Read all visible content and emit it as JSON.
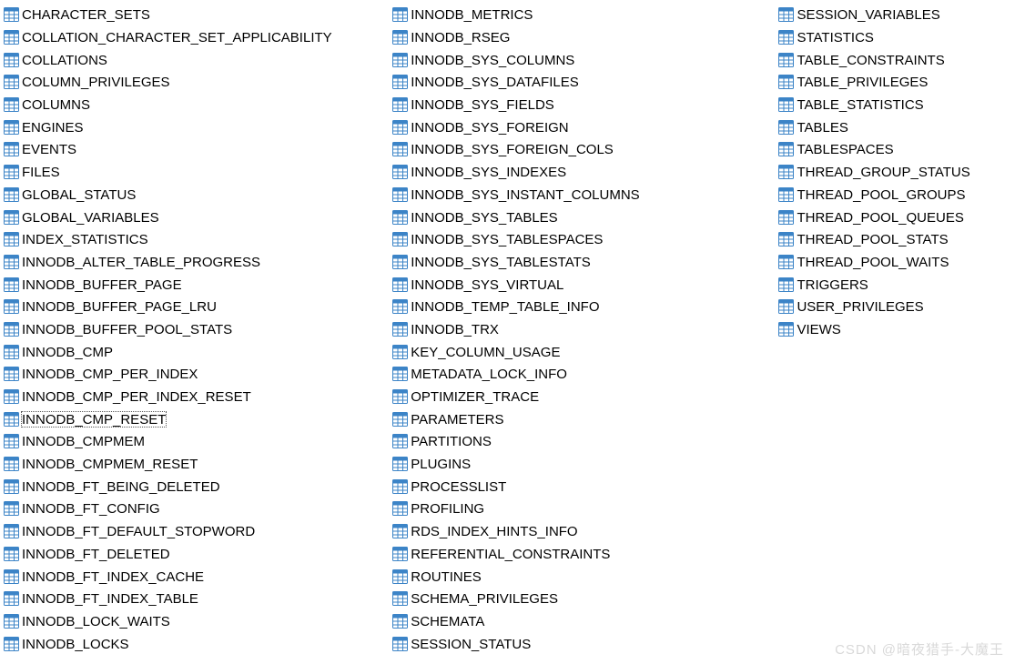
{
  "columns": [
    {
      "items": [
        {
          "label": "CHARACTER_SETS",
          "selected": false
        },
        {
          "label": "COLLATION_CHARACTER_SET_APPLICABILITY",
          "selected": false
        },
        {
          "label": "COLLATIONS",
          "selected": false
        },
        {
          "label": "COLUMN_PRIVILEGES",
          "selected": false
        },
        {
          "label": "COLUMNS",
          "selected": false
        },
        {
          "label": "ENGINES",
          "selected": false
        },
        {
          "label": "EVENTS",
          "selected": false
        },
        {
          "label": "FILES",
          "selected": false
        },
        {
          "label": "GLOBAL_STATUS",
          "selected": false
        },
        {
          "label": "GLOBAL_VARIABLES",
          "selected": false
        },
        {
          "label": "INDEX_STATISTICS",
          "selected": false
        },
        {
          "label": "INNODB_ALTER_TABLE_PROGRESS",
          "selected": false
        },
        {
          "label": "INNODB_BUFFER_PAGE",
          "selected": false
        },
        {
          "label": "INNODB_BUFFER_PAGE_LRU",
          "selected": false
        },
        {
          "label": "INNODB_BUFFER_POOL_STATS",
          "selected": false
        },
        {
          "label": "INNODB_CMP",
          "selected": false
        },
        {
          "label": "INNODB_CMP_PER_INDEX",
          "selected": false
        },
        {
          "label": "INNODB_CMP_PER_INDEX_RESET",
          "selected": false
        },
        {
          "label": "INNODB_CMP_RESET",
          "selected": true
        },
        {
          "label": "INNODB_CMPMEM",
          "selected": false
        },
        {
          "label": "INNODB_CMPMEM_RESET",
          "selected": false
        },
        {
          "label": "INNODB_FT_BEING_DELETED",
          "selected": false
        },
        {
          "label": "INNODB_FT_CONFIG",
          "selected": false
        },
        {
          "label": "INNODB_FT_DEFAULT_STOPWORD",
          "selected": false
        },
        {
          "label": "INNODB_FT_DELETED",
          "selected": false
        },
        {
          "label": "INNODB_FT_INDEX_CACHE",
          "selected": false
        },
        {
          "label": "INNODB_FT_INDEX_TABLE",
          "selected": false
        },
        {
          "label": "INNODB_LOCK_WAITS",
          "selected": false
        },
        {
          "label": "INNODB_LOCKS",
          "selected": false
        }
      ]
    },
    {
      "items": [
        {
          "label": "INNODB_METRICS",
          "selected": false
        },
        {
          "label": "INNODB_RSEG",
          "selected": false
        },
        {
          "label": "INNODB_SYS_COLUMNS",
          "selected": false
        },
        {
          "label": "INNODB_SYS_DATAFILES",
          "selected": false
        },
        {
          "label": "INNODB_SYS_FIELDS",
          "selected": false
        },
        {
          "label": "INNODB_SYS_FOREIGN",
          "selected": false
        },
        {
          "label": "INNODB_SYS_FOREIGN_COLS",
          "selected": false
        },
        {
          "label": "INNODB_SYS_INDEXES",
          "selected": false
        },
        {
          "label": "INNODB_SYS_INSTANT_COLUMNS",
          "selected": false
        },
        {
          "label": "INNODB_SYS_TABLES",
          "selected": false
        },
        {
          "label": "INNODB_SYS_TABLESPACES",
          "selected": false
        },
        {
          "label": "INNODB_SYS_TABLESTATS",
          "selected": false
        },
        {
          "label": "INNODB_SYS_VIRTUAL",
          "selected": false
        },
        {
          "label": "INNODB_TEMP_TABLE_INFO",
          "selected": false
        },
        {
          "label": "INNODB_TRX",
          "selected": false
        },
        {
          "label": "KEY_COLUMN_USAGE",
          "selected": false
        },
        {
          "label": "METADATA_LOCK_INFO",
          "selected": false
        },
        {
          "label": "OPTIMIZER_TRACE",
          "selected": false
        },
        {
          "label": "PARAMETERS",
          "selected": false
        },
        {
          "label": "PARTITIONS",
          "selected": false
        },
        {
          "label": "PLUGINS",
          "selected": false
        },
        {
          "label": "PROCESSLIST",
          "selected": false
        },
        {
          "label": "PROFILING",
          "selected": false
        },
        {
          "label": "RDS_INDEX_HINTS_INFO",
          "selected": false
        },
        {
          "label": "REFERENTIAL_CONSTRAINTS",
          "selected": false
        },
        {
          "label": "ROUTINES",
          "selected": false
        },
        {
          "label": "SCHEMA_PRIVILEGES",
          "selected": false
        },
        {
          "label": "SCHEMATA",
          "selected": false
        },
        {
          "label": "SESSION_STATUS",
          "selected": false
        }
      ]
    },
    {
      "items": [
        {
          "label": "SESSION_VARIABLES",
          "selected": false
        },
        {
          "label": "STATISTICS",
          "selected": false
        },
        {
          "label": "TABLE_CONSTRAINTS",
          "selected": false
        },
        {
          "label": "TABLE_PRIVILEGES",
          "selected": false
        },
        {
          "label": "TABLE_STATISTICS",
          "selected": false
        },
        {
          "label": "TABLES",
          "selected": false
        },
        {
          "label": "TABLESPACES",
          "selected": false
        },
        {
          "label": "THREAD_GROUP_STATUS",
          "selected": false
        },
        {
          "label": "THREAD_POOL_GROUPS",
          "selected": false
        },
        {
          "label": "THREAD_POOL_QUEUES",
          "selected": false
        },
        {
          "label": "THREAD_POOL_STATS",
          "selected": false
        },
        {
          "label": "THREAD_POOL_WAITS",
          "selected": false
        },
        {
          "label": "TRIGGERS",
          "selected": false
        },
        {
          "label": "USER_PRIVILEGES",
          "selected": false
        },
        {
          "label": "VIEWS",
          "selected": false
        }
      ]
    }
  ],
  "watermark": "CSDN @暗夜猎手-大魔王"
}
